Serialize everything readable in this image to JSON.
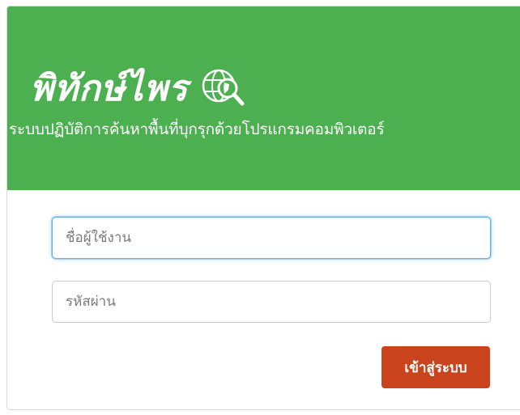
{
  "header": {
    "app_title": "พิทักษ์ไพร",
    "subtitle": "ระบบปฏิบัติการค้นหาพื้นที่บุกรุกด้วยโปรแกรมคอมพิวเตอร์",
    "logo_icon": "globe-magnifier-icon",
    "background_color": "#4caf50"
  },
  "login_form": {
    "username": {
      "placeholder": "ชื่อผู้ใช้งาน",
      "value": ""
    },
    "password": {
      "placeholder": "รหัสผ่าน",
      "value": ""
    },
    "submit_label": "เข้าสู่ระบบ",
    "submit_color": "#c9441c"
  }
}
